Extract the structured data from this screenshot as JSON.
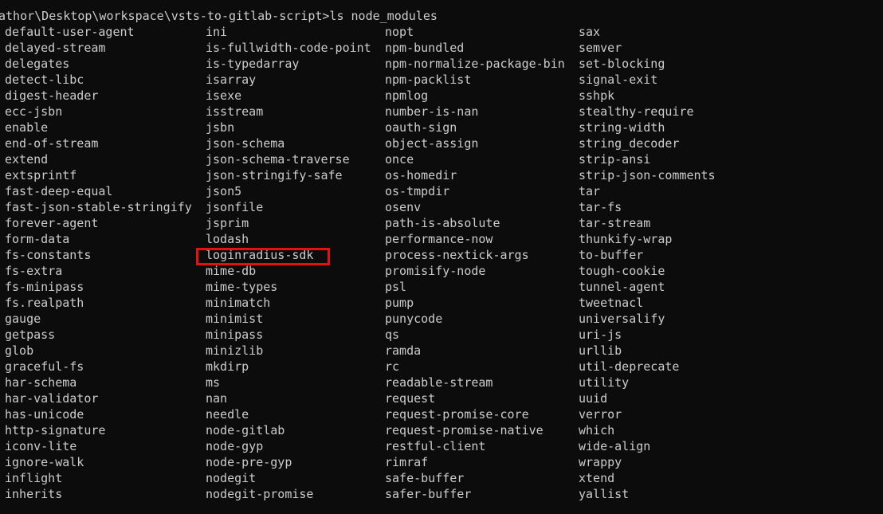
{
  "terminal": {
    "prompt": "athor\\Desktop\\workspace\\vsts-to-gitlab-script>",
    "command": "ls node_modules",
    "highlight_color": "#e8100c",
    "highlighted_entry": "loginradius-sdk",
    "columns": [
      [
        "default-user-agent",
        "delayed-stream",
        "delegates",
        "detect-libc",
        "digest-header",
        "ecc-jsbn",
        "enable",
        "end-of-stream",
        "extend",
        "extsprintf",
        "fast-deep-equal",
        "fast-json-stable-stringify",
        "forever-agent",
        "form-data",
        "fs-constants",
        "fs-extra",
        "fs-minipass",
        "fs.realpath",
        "gauge",
        "getpass",
        "glob",
        "graceful-fs",
        "har-schema",
        "har-validator",
        "has-unicode",
        "http-signature",
        "iconv-lite",
        "ignore-walk",
        "inflight",
        "inherits"
      ],
      [
        "ini",
        "is-fullwidth-code-point",
        "is-typedarray",
        "isarray",
        "isexe",
        "isstream",
        "jsbn",
        "json-schema",
        "json-schema-traverse",
        "json-stringify-safe",
        "json5",
        "jsonfile",
        "jsprim",
        "lodash",
        "loginradius-sdk",
        "mime-db",
        "mime-types",
        "minimatch",
        "minimist",
        "minipass",
        "minizlib",
        "mkdirp",
        "ms",
        "nan",
        "needle",
        "node-gitlab",
        "node-gyp",
        "node-pre-gyp",
        "nodegit",
        "nodegit-promise"
      ],
      [
        "nopt",
        "npm-bundled",
        "npm-normalize-package-bin",
        "npm-packlist",
        "npmlog",
        "number-is-nan",
        "oauth-sign",
        "object-assign",
        "once",
        "os-homedir",
        "os-tmpdir",
        "osenv",
        "path-is-absolute",
        "performance-now",
        "process-nextick-args",
        "promisify-node",
        "psl",
        "pump",
        "punycode",
        "qs",
        "ramda",
        "rc",
        "readable-stream",
        "request",
        "request-promise-core",
        "request-promise-native",
        "restful-client",
        "rimraf",
        "safe-buffer",
        "safer-buffer"
      ],
      [
        "sax",
        "semver",
        "set-blocking",
        "signal-exit",
        "sshpk",
        "stealthy-require",
        "string-width",
        "string_decoder",
        "strip-ansi",
        "strip-json-comments",
        "tar",
        "tar-fs",
        "tar-stream",
        "thunkify-wrap",
        "to-buffer",
        "tough-cookie",
        "tunnel-agent",
        "tweetnacl",
        "universalify",
        "uri-js",
        "urllib",
        "util-deprecate",
        "utility",
        "uuid",
        "verror",
        "which",
        "wide-align",
        "wrappy",
        "xtend",
        "yallist"
      ]
    ]
  }
}
